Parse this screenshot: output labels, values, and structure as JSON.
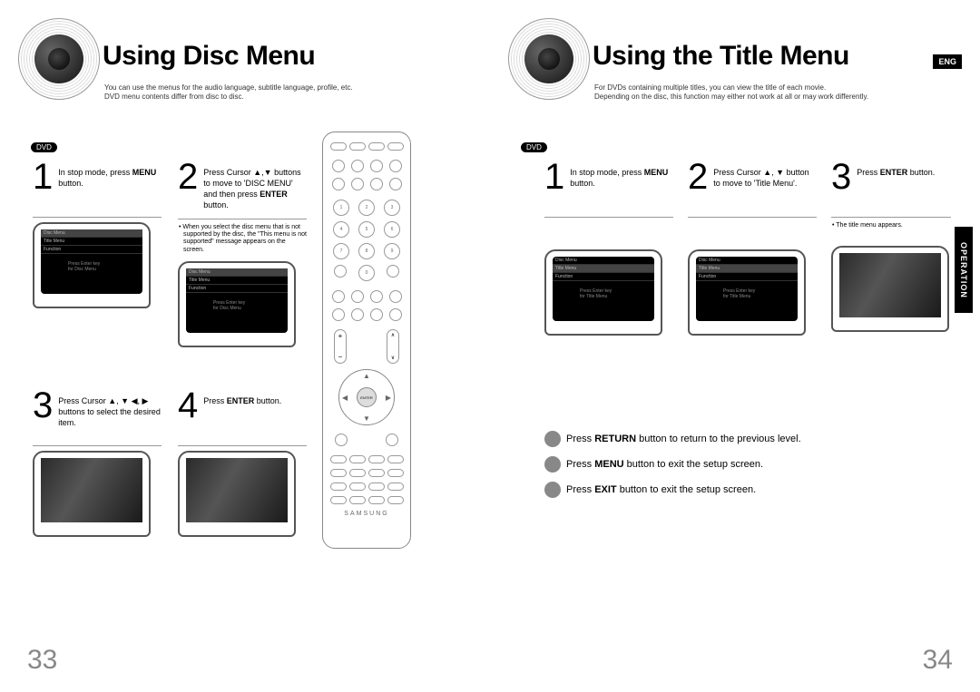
{
  "left": {
    "title": "Using Disc Menu",
    "subtitle": "You can use the menus for the audio language, subtitle language, profile, etc.\nDVD menu contents differ from disc to disc.",
    "dvd_badge": "DVD",
    "steps": {
      "s1": {
        "num": "1",
        "text_pre": "In stop mode, press ",
        "bold": "MENU",
        "text_post": " button."
      },
      "s2": {
        "num": "2",
        "text": "Press Cursor ▲,▼ buttons to move to 'DISC MENU' and then press ",
        "bold": "ENTER",
        "text_post": " button."
      },
      "s2_note": "When you select the disc menu that is not supported by the disc, the \"This menu is not supported\" message appears on the screen.",
      "s3": {
        "num": "3",
        "text": "Press Cursor ▲, ▼ ◀, ▶ buttons to select the desired item."
      },
      "s4": {
        "num": "4",
        "text_pre": "Press ",
        "bold": "ENTER",
        "text_post": " button."
      }
    },
    "page_num": "33"
  },
  "right": {
    "title": "Using the Title Menu",
    "subtitle": "For DVDs containing multiple titles, you can view the title of each movie.\nDepending on the disc, this function may either not work at all or may work differently.",
    "eng": "ENG",
    "dvd_badge": "DVD",
    "operation_tab": "OPERATION",
    "steps": {
      "s1": {
        "num": "1",
        "text_pre": "In stop mode, press ",
        "bold": "MENU",
        "text_post": " button."
      },
      "s2": {
        "num": "2",
        "text": "Press Cursor ▲, ▼ button to move to 'Title Menu'."
      },
      "s3": {
        "num": "3",
        "text_pre": "Press ",
        "bold": "ENTER",
        "text_post": " button."
      },
      "s3_note": "The title menu appears."
    },
    "bullets": {
      "b1": {
        "pre": "Press ",
        "bold": "RETURN",
        "post": " button to return to the previous level."
      },
      "b2": {
        "pre": "Press ",
        "bold": "MENU",
        "post": " button to exit the setup screen."
      },
      "b3": {
        "pre": "Press ",
        "bold": "EXIT",
        "post": " button to exit the setup screen."
      }
    },
    "page_num": "34"
  },
  "remote": {
    "brand": "SAMSUNG",
    "enter": "ENTER"
  }
}
